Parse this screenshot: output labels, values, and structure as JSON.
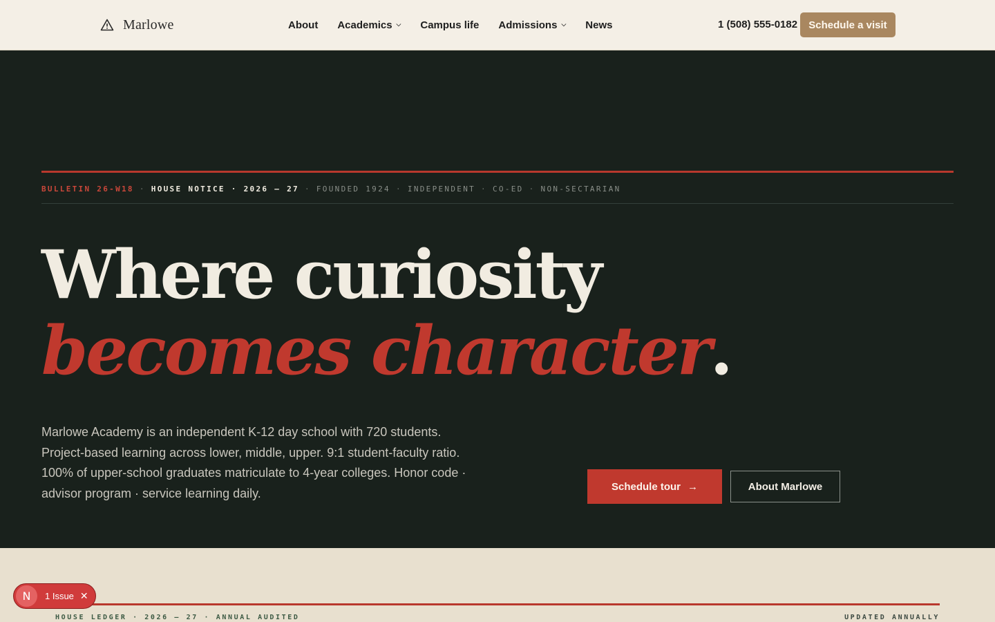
{
  "header": {
    "brand": "Marlowe",
    "nav": [
      {
        "label": "About",
        "dropdown": false
      },
      {
        "label": "Academics",
        "dropdown": true
      },
      {
        "label": "Campus life",
        "dropdown": false
      },
      {
        "label": "Admissions",
        "dropdown": true
      },
      {
        "label": "News",
        "dropdown": false
      }
    ],
    "phone": "1 (508) 555-0182",
    "cta": "Schedule a visit"
  },
  "hero": {
    "bulletin_id": "BULLETIN 26-W18",
    "notice": "HOUSE NOTICE · 2026 — 27",
    "meta": [
      "FOUNDED 1924",
      "INDEPENDENT",
      "CO-ED",
      "NON-SECTARIAN"
    ],
    "headline_line1": "Where curiosity",
    "headline_line2": "becomes character",
    "headline_period": ".",
    "lede": "Marlowe Academy is an independent K-12 day school with 720 students. Project-based learning across lower, middle, upper. 9:1 student-faculty ratio. 100% of upper-school graduates matriculate to 4-year colleges. Honor code · advisor program · service learning daily.",
    "primary_cta": "Schedule tour",
    "secondary_cta": "About Marlowe"
  },
  "ledger": {
    "left": "HOUSE LEDGER · 2026 — 27 · ANNUAL AUDITED",
    "right": "UPDATED ANNUALLY"
  },
  "issue_toast": {
    "badge": "N",
    "label": "1 Issue"
  },
  "colors": {
    "hero_bg": "#19211c",
    "accent_red": "#c0392e",
    "cta_tan": "#a98760",
    "cream": "#f4efe6"
  },
  "icons": [
    "warning-triangle-icon",
    "chevron-down-icon",
    "arrow-right-icon",
    "close-icon"
  ]
}
